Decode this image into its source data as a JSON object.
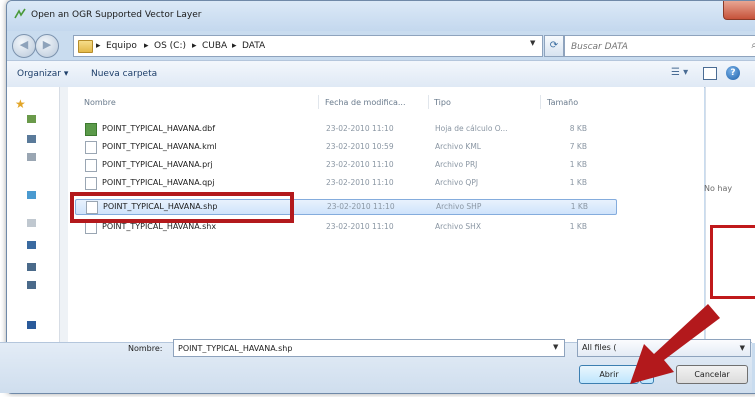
{
  "window": {
    "title": "Open an OGR Supported Vector Layer"
  },
  "address": {
    "crumbs": [
      "Equipo",
      "OS (C:)",
      "CUBA",
      "DATA"
    ],
    "separator": "▸"
  },
  "search": {
    "placeholder": "Buscar DATA"
  },
  "toolbar": {
    "organize_label": "Organizar ▾",
    "new_folder_label": "Nueva carpeta"
  },
  "columns": {
    "name": "Nombre",
    "date": "Fecha de modifica...",
    "type": "Tipo",
    "size": "Tamaño"
  },
  "files": [
    {
      "name": "POINT_TYPICAL_HAVANA.dbf",
      "date": "23-02-2010 11:10",
      "type": "Hoja de cálculo O...",
      "size": "8 KB"
    },
    {
      "name": "POINT_TYPICAL_HAVANA.kml",
      "date": "23-02-2010 10:59",
      "type": "Archivo KML",
      "size": "7 KB"
    },
    {
      "name": "POINT_TYPICAL_HAVANA.prj",
      "date": "23-02-2010 11:10",
      "type": "Archivo PRJ",
      "size": "1 KB"
    },
    {
      "name": "POINT_TYPICAL_HAVANA.qpj",
      "date": "23-02-2010 11:10",
      "type": "Archivo QPJ",
      "size": "1 KB"
    },
    {
      "name": "POINT_TYPICAL_HAVANA.shp",
      "date": "23-02-2010 11:10",
      "type": "Archivo SHP",
      "size": "1 KB"
    },
    {
      "name": "POINT_TYPICAL_HAVANA.shx",
      "date": "23-02-2010 11:10",
      "type": "Archivo SHX",
      "size": "1 KB"
    }
  ],
  "preview": {
    "text": "No hay"
  },
  "footer": {
    "filename_label": "Nombre:",
    "filename_value": "POINT_TYPICAL_HAVANA.shp",
    "filter_label": "All files (",
    "open_label": "Abrir",
    "cancel_label": "Cancelar"
  },
  "colors": {
    "annotation_red": "#b3191c",
    "selection_blue": "#cfe3fb"
  }
}
